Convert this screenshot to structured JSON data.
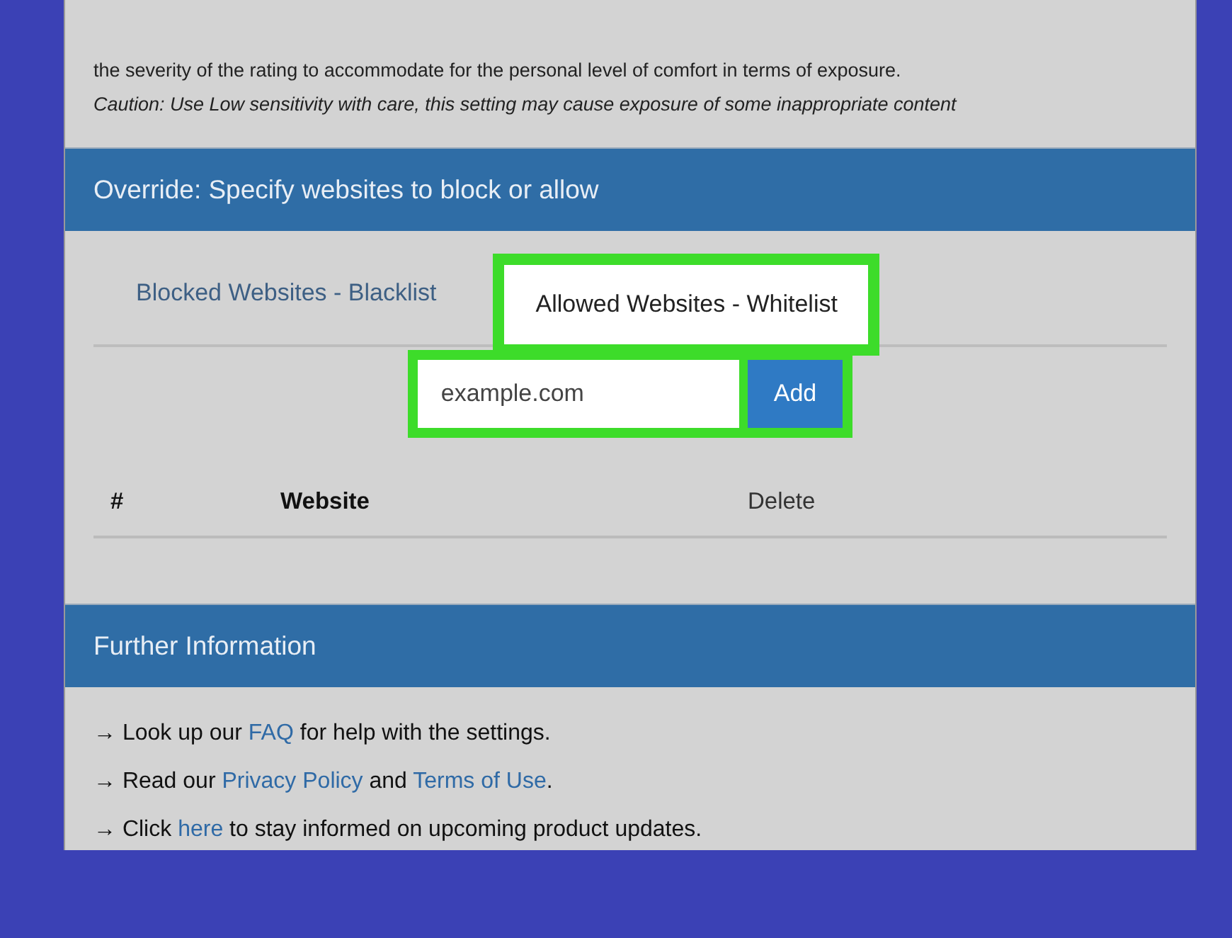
{
  "intro": {
    "lines": [
      "the severity of the rating to accommodate for the personal level of comfort in terms of exposure."
    ],
    "caution": "Caution: Use Low sensitivity with care, this setting may cause exposure of some inappropriate content"
  },
  "override": {
    "title": "Override: Specify websites to block or allow",
    "tabs": [
      {
        "label": "Blocked Websites - Blacklist",
        "selected": false,
        "highlighted": false
      },
      {
        "label": "Allowed Websites - Whitelist",
        "selected": true,
        "highlighted": true
      }
    ],
    "input": {
      "placeholder": "example.com",
      "highlighted": true
    },
    "add_button": "Add",
    "table": {
      "columns": [
        "#",
        "Website",
        "Delete"
      ]
    }
  },
  "info": {
    "title": "Further Information",
    "lines": [
      [
        {
          "text": "→ Look up our ",
          "kind": "text"
        },
        {
          "text": "FAQ",
          "kind": "link"
        },
        {
          "text": " for help with the settings.",
          "kind": "text"
        }
      ],
      [
        {
          "text": "→ Read our ",
          "kind": "text"
        },
        {
          "text": "Privacy Policy",
          "kind": "link"
        },
        {
          "text": " and ",
          "kind": "text"
        },
        {
          "text": "Terms of Use",
          "kind": "link"
        },
        {
          "text": ".",
          "kind": "text"
        }
      ],
      [
        {
          "text": "→ Click ",
          "kind": "text"
        },
        {
          "text": "here",
          "kind": "link"
        },
        {
          "text": " to stay informed on upcoming product updates.",
          "kind": "text"
        }
      ]
    ]
  }
}
